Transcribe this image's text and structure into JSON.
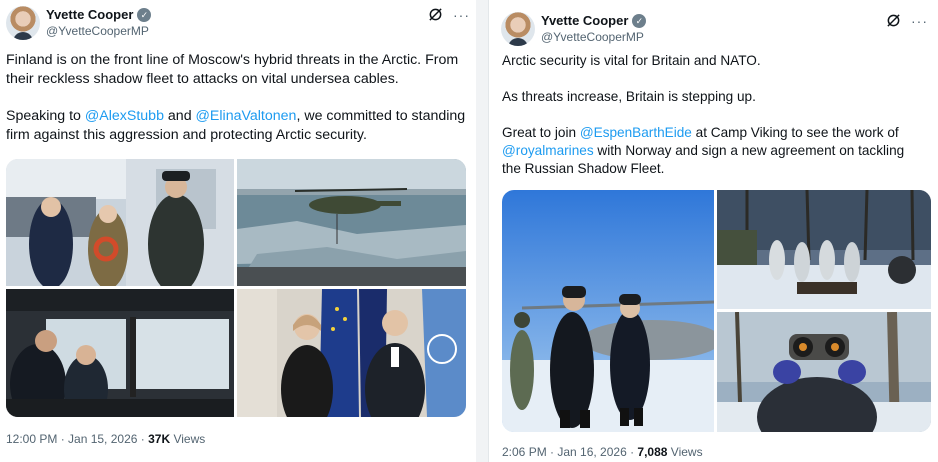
{
  "tweet1": {
    "name": "Yvette Cooper",
    "handle": "@YvetteCooperMP",
    "text1": "Finland is on the front line of Moscow's hybrid threats in the Arctic. From their reckless shadow fleet to attacks on vital undersea cables.",
    "text2_pre": "Speaking to ",
    "mention1": "@AlexStubb",
    "text2_mid": " and ",
    "mention2": "@ElinaValtonen",
    "text2_post": ", we committed to standing firm against this aggression and protecting Arctic security.",
    "time": "12:00 PM · Jan 15, 2026 · ",
    "views_count": "37K",
    "views_label": " Views"
  },
  "tweet2": {
    "name": "Yvette Cooper",
    "handle": "@YvetteCooperMP",
    "line1": "Arctic security is vital for Britain and NATO.",
    "line2": "As threats increase, Britain is stepping up.",
    "text3_pre": "Great to join ",
    "mention1": "@EspenBarthEide",
    "text3_mid": " at Camp Viking to see the work of ",
    "mention2": "@royalmarines",
    "text3_post": " with Norway and sign a new agreement on tackling the Russian Shadow Fleet.",
    "time": "2:06 PM · Jan 16, 2026 · ",
    "views_count": "7,088",
    "views_label": " Views"
  },
  "icons": {
    "verified": "verified-badge-icon",
    "grok": "grok-icon",
    "more": "more-icon"
  },
  "colors": {
    "mention": "#1d9bf0",
    "secondary_text": "#536471",
    "verified_badge": "#6d7f8c"
  }
}
